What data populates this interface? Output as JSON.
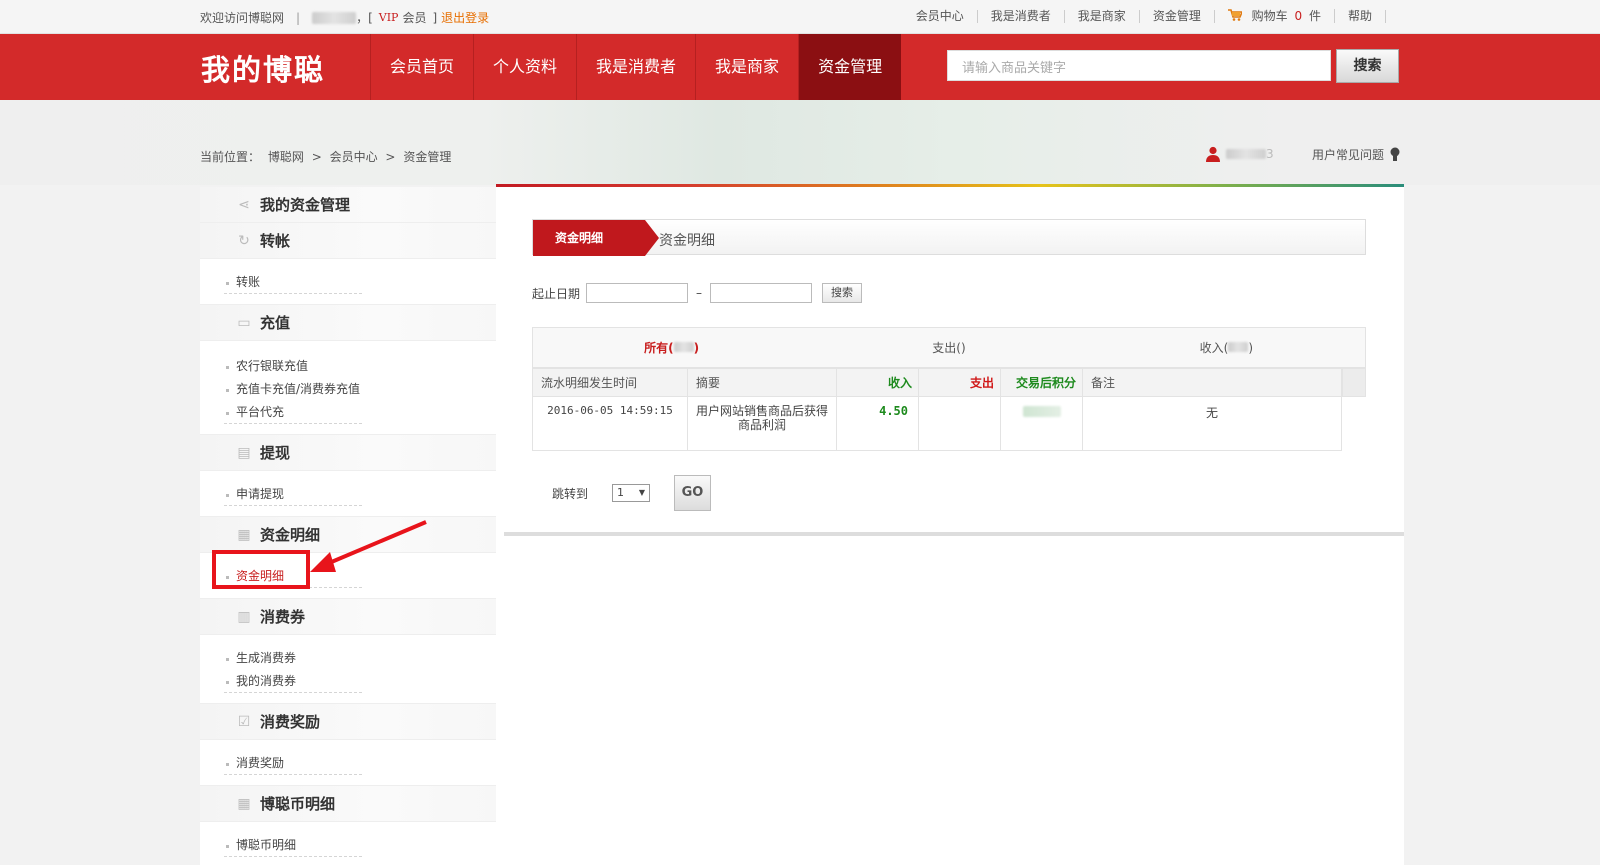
{
  "topbar": {
    "welcome": "欢迎访问博聪网",
    "sep": "|",
    "vip_prefix": "，[",
    "vip": "VIP",
    "member": "会员",
    "vip_suffix": "]",
    "logout": "退出登录",
    "links": [
      "会员中心",
      "我是消费者",
      "我是商家",
      "资金管理"
    ],
    "cart_label": "购物车",
    "cart_count": "0",
    "cart_unit": "件",
    "help": "帮助"
  },
  "header": {
    "logo": "我的博聪",
    "nav": [
      "会员首页",
      "个人资料",
      "我是消费者",
      "我是商家",
      "资金管理"
    ],
    "active_nav": "资金管理",
    "search_placeholder": "请输入商品关键字",
    "search_button": "搜索"
  },
  "breadcrumb": {
    "label": "当前位置：",
    "items": [
      "博聪网",
      "会员中心",
      "资金管理"
    ],
    "sep": ">"
  },
  "user": {
    "suffix": "3",
    "faq": "用户常见问题"
  },
  "sidebar": {
    "title": "我的资金管理",
    "groups": [
      {
        "title": "转帐",
        "icon": "refresh-icon",
        "items": [
          "转账"
        ]
      },
      {
        "title": "充值",
        "icon": "card-icon",
        "items": [
          "农行银联充值",
          "充值卡充值/消费券充值",
          "平台代充"
        ]
      },
      {
        "title": "提现",
        "icon": "printer-icon",
        "items": [
          "申请提现"
        ]
      },
      {
        "title": "资金明细",
        "icon": "ledger-icon",
        "items": [
          "资金明细"
        ]
      },
      {
        "title": "消费券",
        "icon": "map-icon",
        "items": [
          "生成消费券",
          "我的消费券"
        ]
      },
      {
        "title": "消费奖励",
        "icon": "checkbox-icon",
        "items": [
          "消费奖励"
        ]
      },
      {
        "title": "博聪币明细",
        "icon": "ledger-icon",
        "items": [
          "博聪币明细"
        ]
      }
    ]
  },
  "main": {
    "tab_active": "资金明细",
    "tab_label": "资金明细",
    "date_label": "起止日期",
    "date_dash": "–",
    "search_btn": "搜索",
    "filters": [
      {
        "label": "所有(",
        "suffix": ")"
      },
      {
        "label": "支出()",
        "suffix": ""
      },
      {
        "label": "收入(",
        "suffix": ")"
      }
    ],
    "columns": [
      "流水明细发生时间",
      "摘要",
      "收入",
      "支出",
      "交易后积分",
      "备注"
    ],
    "rows": [
      {
        "time": "2016-06-05 14:59:15",
        "memo": "用户网站销售商品后获得商品利润",
        "income": "4.50",
        "expense": "",
        "remark": "无"
      }
    ],
    "jump_label": "跳转到",
    "page": "1",
    "go": "GO"
  },
  "colors": {
    "brand_red": "#d32a2a",
    "active_nav": "#8b0f12",
    "income_green": "#1d8a1d",
    "annotation_red": "#e8141b"
  }
}
